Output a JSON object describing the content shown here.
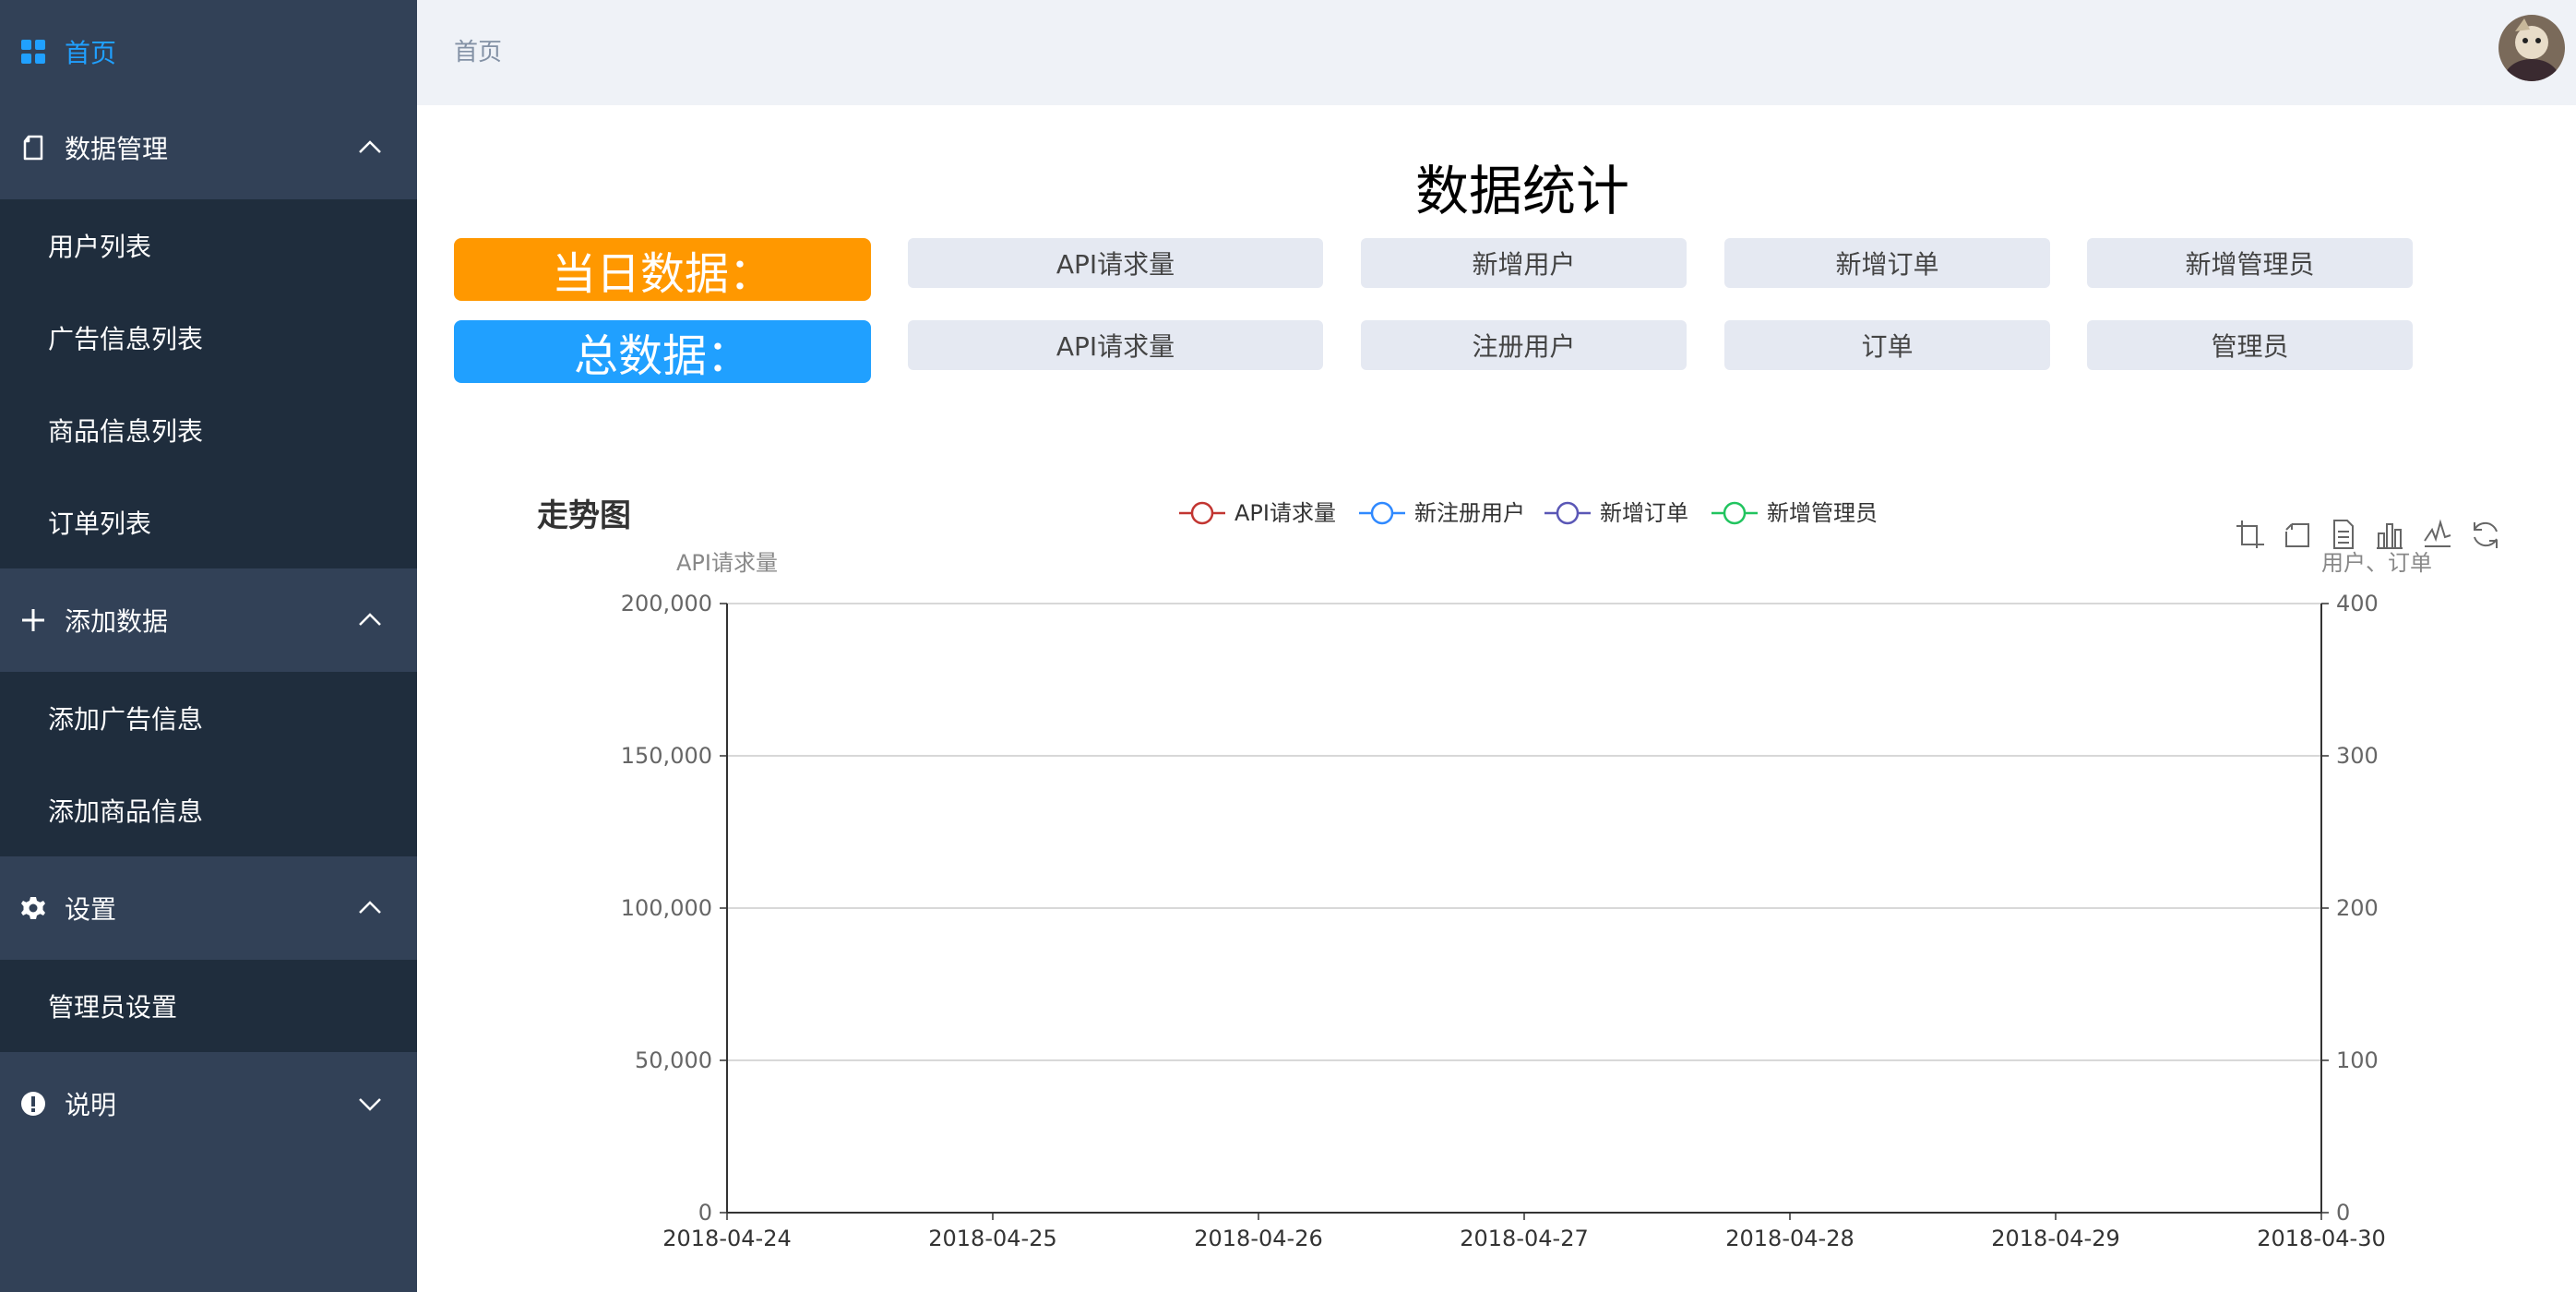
{
  "sidebar": {
    "home": {
      "label": "首页",
      "icon": "grid-icon",
      "active_color": "#20a0ff"
    },
    "groups": [
      {
        "label": "数据管理",
        "icon": "document-icon",
        "expanded": true,
        "items": [
          {
            "label": "用户列表"
          },
          {
            "label": "广告信息列表"
          },
          {
            "label": "商品信息列表"
          },
          {
            "label": "订单列表"
          }
        ]
      },
      {
        "label": "添加数据",
        "icon": "plus-icon",
        "expanded": true,
        "items": [
          {
            "label": "添加广告信息"
          },
          {
            "label": "添加商品信息"
          }
        ]
      },
      {
        "label": "设置",
        "icon": "gear-icon",
        "expanded": true,
        "items": [
          {
            "label": "管理员设置"
          }
        ]
      },
      {
        "label": "说明",
        "icon": "info-icon",
        "expanded": false,
        "items": []
      }
    ]
  },
  "header": {
    "breadcrumb": "首页",
    "avatar_icon": "user-avatar"
  },
  "main": {
    "title": "数据统计",
    "today": {
      "label": "当日数据：",
      "color": "#ff9800",
      "stats": [
        "API请求量",
        "新增用户",
        "新增订单",
        "新增管理员"
      ]
    },
    "total": {
      "label": "总数据：",
      "color": "#20a0ff",
      "stats": [
        "API请求量",
        "注册用户",
        "订单",
        "管理员"
      ]
    }
  },
  "chart_data": {
    "type": "line",
    "title": "走势图",
    "x": [
      "2018-04-24",
      "2018-04-25",
      "2018-04-26",
      "2018-04-27",
      "2018-04-28",
      "2018-04-29",
      "2018-04-30"
    ],
    "series": [
      {
        "name": "API请求量",
        "color": "#c23531",
        "axis": "left",
        "values": []
      },
      {
        "name": "新注册用户",
        "color": "#2f89ff",
        "axis": "right",
        "values": []
      },
      {
        "name": "新增订单",
        "color": "#5a57b6",
        "axis": "right",
        "values": []
      },
      {
        "name": "新增管理员",
        "color": "#21c45f",
        "axis": "right",
        "values": []
      }
    ],
    "y_left": {
      "label": "API请求量",
      "ylim": [
        0,
        200000
      ],
      "ticks": [
        "0",
        "50,000",
        "100,000",
        "150,000",
        "200,000"
      ]
    },
    "y_right": {
      "label": "用户、订单",
      "ylim": [
        0,
        400
      ],
      "ticks": [
        "0",
        "100",
        "200",
        "300",
        "400"
      ]
    },
    "grid": true,
    "legend_position": "top-center",
    "toolbox": [
      "zoom-icon",
      "zoom-reset-icon",
      "data-view-icon",
      "bar-chart-icon",
      "line-chart-icon",
      "restore-icon"
    ]
  }
}
